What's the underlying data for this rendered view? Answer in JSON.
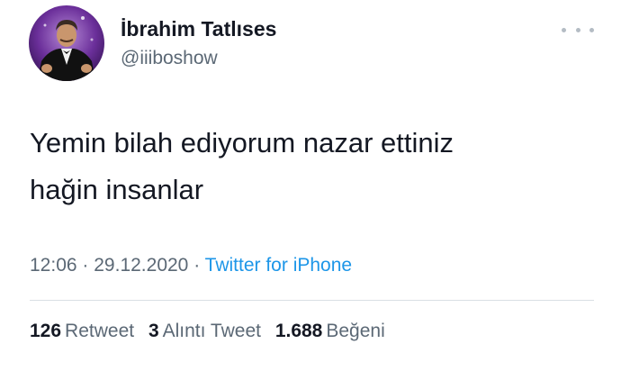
{
  "tweet": {
    "author": {
      "name": "İbrahim Tatlıses",
      "handle": "@iiiboshow"
    },
    "text_line1": "Yemin bilah ediyorum nazar ettiniz",
    "text_line2": "hağin insanlar",
    "time": "12:06",
    "separator": "·",
    "date": "29.12.2020",
    "source": "Twitter for iPhone",
    "stats": {
      "retweets_count": "126",
      "retweets_label": "Retweet",
      "quotes_count": "3",
      "quotes_label": "Alıntı Tweet",
      "likes_count": "1.688",
      "likes_label": "Beğeni"
    }
  },
  "icons": {
    "more": "more-options-icon"
  },
  "colors": {
    "text_primary": "#141823",
    "text_secondary": "#5b6875",
    "link": "#1d96e8",
    "divider": "#d9dfe4",
    "avatar_bg": "#5a2a8a"
  }
}
